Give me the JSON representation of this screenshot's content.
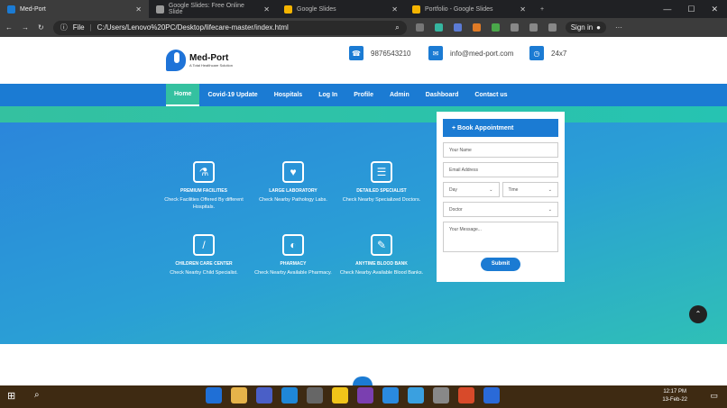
{
  "browser": {
    "tabs": [
      {
        "title": "Med-Port",
        "active": true,
        "color": "#1b7bd3"
      },
      {
        "title": "Google Slides: Free Online Slide",
        "active": false,
        "color": "#999"
      },
      {
        "title": "Google Slides",
        "active": false,
        "color": "#f4b400"
      },
      {
        "title": "Portfolio - Google Slides",
        "active": false,
        "color": "#f4b400"
      }
    ],
    "file_label": "File",
    "url": "C:/Users/Lenovo%20PC/Desktop/lifecare-master/index.html",
    "signin_label": "Sign in"
  },
  "header": {
    "brand": "Med-Port",
    "tagline": "A Total Healthcare Solution",
    "phone": "9876543210",
    "email": "info@med-port.com",
    "hours": "24x7"
  },
  "nav": [
    "Home",
    "Covid-19 Update",
    "Hospitals",
    "Log In",
    "Profile",
    "Admin",
    "Dashboard",
    "Contact us"
  ],
  "features": [
    {
      "title": "PREMIUM FACILITIES",
      "desc": "Check Facilities Offered By different Hospitals.",
      "icon": "microscope-icon"
    },
    {
      "title": "LARGE LABORATORY",
      "desc": "Check Nearby Pathology Labs.",
      "icon": "monitor-heart-icon"
    },
    {
      "title": "DETAILED SPECIALIST",
      "desc": "Check Nearby Specialized Doctors.",
      "icon": "clipboard-icon"
    },
    {
      "title": "CHILDREN CARE CENTER",
      "desc": "Check Nearby Child Specialist.",
      "icon": "thermometer-icon"
    },
    {
      "title": "PHARMACY",
      "desc": "Check Nearby Available Pharmacy.",
      "icon": "pill-icon"
    },
    {
      "title": "ANYTIME BLOOD BANK",
      "desc": "Check Nearby Available Blood Banks.",
      "icon": "syringe-icon"
    }
  ],
  "appointment": {
    "heading": "+ Book Appointment",
    "name_placeholder": "Your Name",
    "email_placeholder": "Email Address",
    "day_label": "Day",
    "time_label": "Time",
    "doctor_label": "Doctor",
    "message_placeholder": "Your Message...",
    "submit_label": "Submit"
  },
  "taskbar": {
    "time": "12:17 PM",
    "date": "13-Feb-22"
  }
}
